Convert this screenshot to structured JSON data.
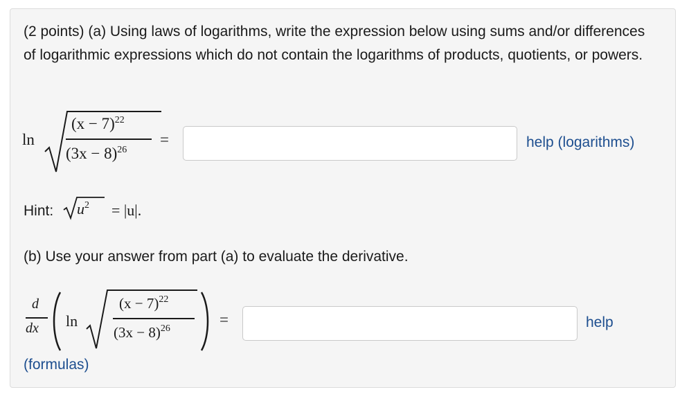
{
  "problem": {
    "points": "(2 points)",
    "part_a_text": "(a) Using laws of logarithms, write the expression below using sums and/or differences of logarithmic expressions which do not contain the logarithms of products, quotients, or powers.",
    "expression": {
      "ln": "ln",
      "numerator_base": "(x − 7)",
      "numerator_exp": "22",
      "denominator_base": "(3x − 8)",
      "denominator_exp": "26",
      "equals": "="
    },
    "input_a_value": "",
    "help_a_label": "help (logarithms)",
    "hint_label": "Hint:",
    "hint_u": "u",
    "hint_exp": "2",
    "hint_rhs": "= |u|.",
    "part_b_text": "(b) Use your answer from part (a) to evaluate the derivative.",
    "derivative": {
      "d": "d",
      "dx": "dx",
      "ln": "ln",
      "numerator_base": "(x − 7)",
      "numerator_exp": "22",
      "denominator_base": "(3x − 8)",
      "denominator_exp": "26",
      "equals": "="
    },
    "input_b_value": "",
    "help_b_label": "help",
    "formulas_label": "(formulas)"
  }
}
